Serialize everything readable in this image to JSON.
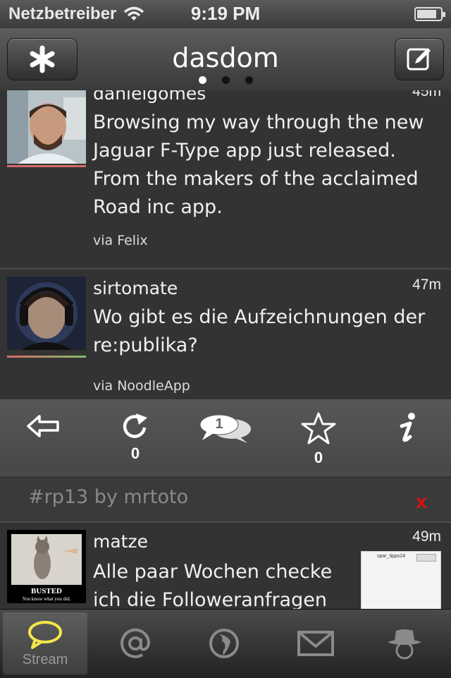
{
  "statusbar": {
    "carrier": "Netzbetreiber",
    "time": "9:19 PM",
    "battery_level": 0.85
  },
  "navbar": {
    "title": "dasdom",
    "left_icon": "asterisk-icon",
    "right_icon": "compose-icon",
    "pages": 3,
    "active_page": 0
  },
  "tweets": [
    {
      "username": "danielgomes",
      "time": "45m",
      "text": "Browsing my way through the new Jaguar F-Type app just released. From the makers of the acclaimed Road inc app.",
      "via": "via Felix"
    },
    {
      "username": "sirtomate",
      "time": "47m",
      "text": "Wo gibt es die Aufzeichnungen der re:publika?",
      "via": "via NoodleApp"
    },
    {
      "username": "matze",
      "time": "49m",
      "text": "Alle paar Wochen checke ich die Followeranfragen",
      "avatar_caption": "BUSTED",
      "avatar_subcaption": "You know what you did.",
      "thumb_title": "spar_tipps24"
    }
  ],
  "actions": {
    "reply_icon": "reply-arrow-icon",
    "repost_icon": "repost-icon",
    "repost_count": "0",
    "conversation_icon": "conversation-bubbles-icon",
    "conversation_count": "1",
    "star_icon": "star-icon",
    "star_count": "0",
    "info_icon": "info-icon"
  },
  "tagbar": {
    "text": "#rp13 by mrtoto",
    "close": "x"
  },
  "tabbar": {
    "items": [
      {
        "label": "Stream",
        "icon": "speech-bubble-icon",
        "active": true
      },
      {
        "label": "",
        "icon": "mentions-at-icon"
      },
      {
        "label": "",
        "icon": "globe-icon"
      },
      {
        "label": "",
        "icon": "mail-icon"
      },
      {
        "label": "",
        "icon": "profile-hat-icon"
      }
    ]
  },
  "colors": {
    "accent_yellow": "#f5e64a",
    "close_red": "#e01010"
  }
}
